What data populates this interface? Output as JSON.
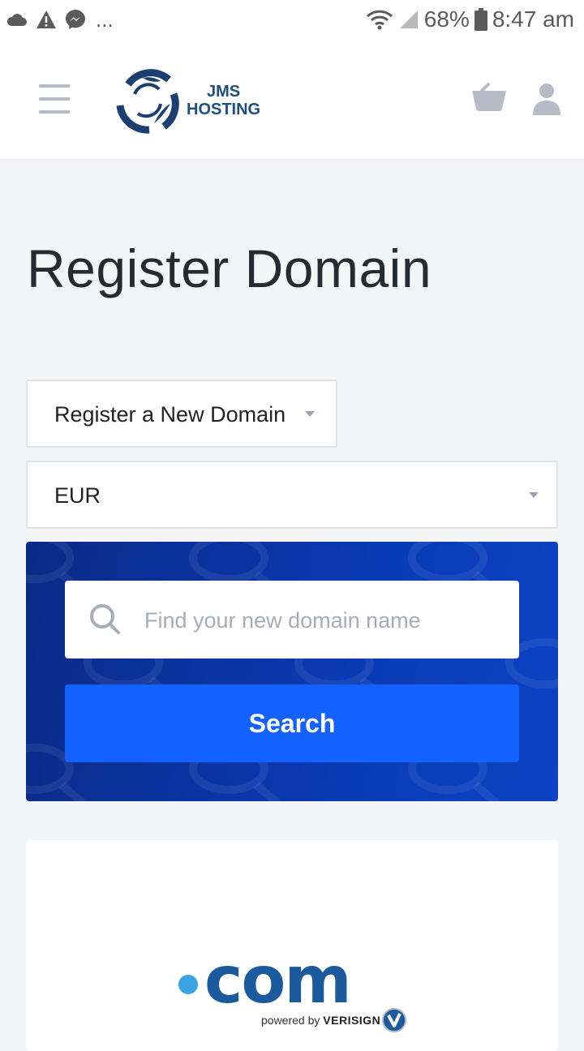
{
  "status_bar": {
    "overflow_dots": "...",
    "battery_percent": "68%",
    "time": "8:47 am",
    "left_icons": [
      "cloud-icon",
      "warning-icon",
      "messenger-icon"
    ],
    "right_icons": [
      "wifi-icon",
      "signal-icon",
      "battery-icon"
    ]
  },
  "header": {
    "logo_line1": "JMS",
    "logo_line2": "HOSTING",
    "icons": [
      "menu-icon",
      "cart-icon",
      "user-icon"
    ]
  },
  "page_title": "Register Domain",
  "domain_action": {
    "selected": "Register a New Domain"
  },
  "currency": {
    "selected": "EUR"
  },
  "search": {
    "placeholder": "Find your new domain name",
    "button_label": "Search"
  },
  "promo": {
    "tld": "com",
    "powered_by": "powered by",
    "brand": "VERISIGN"
  },
  "colors": {
    "primary_button": "#1361ff",
    "panel_dark": "#0b2a86",
    "logo_blue": "#1f4f80",
    "page_bg": "#f4f5f7"
  }
}
